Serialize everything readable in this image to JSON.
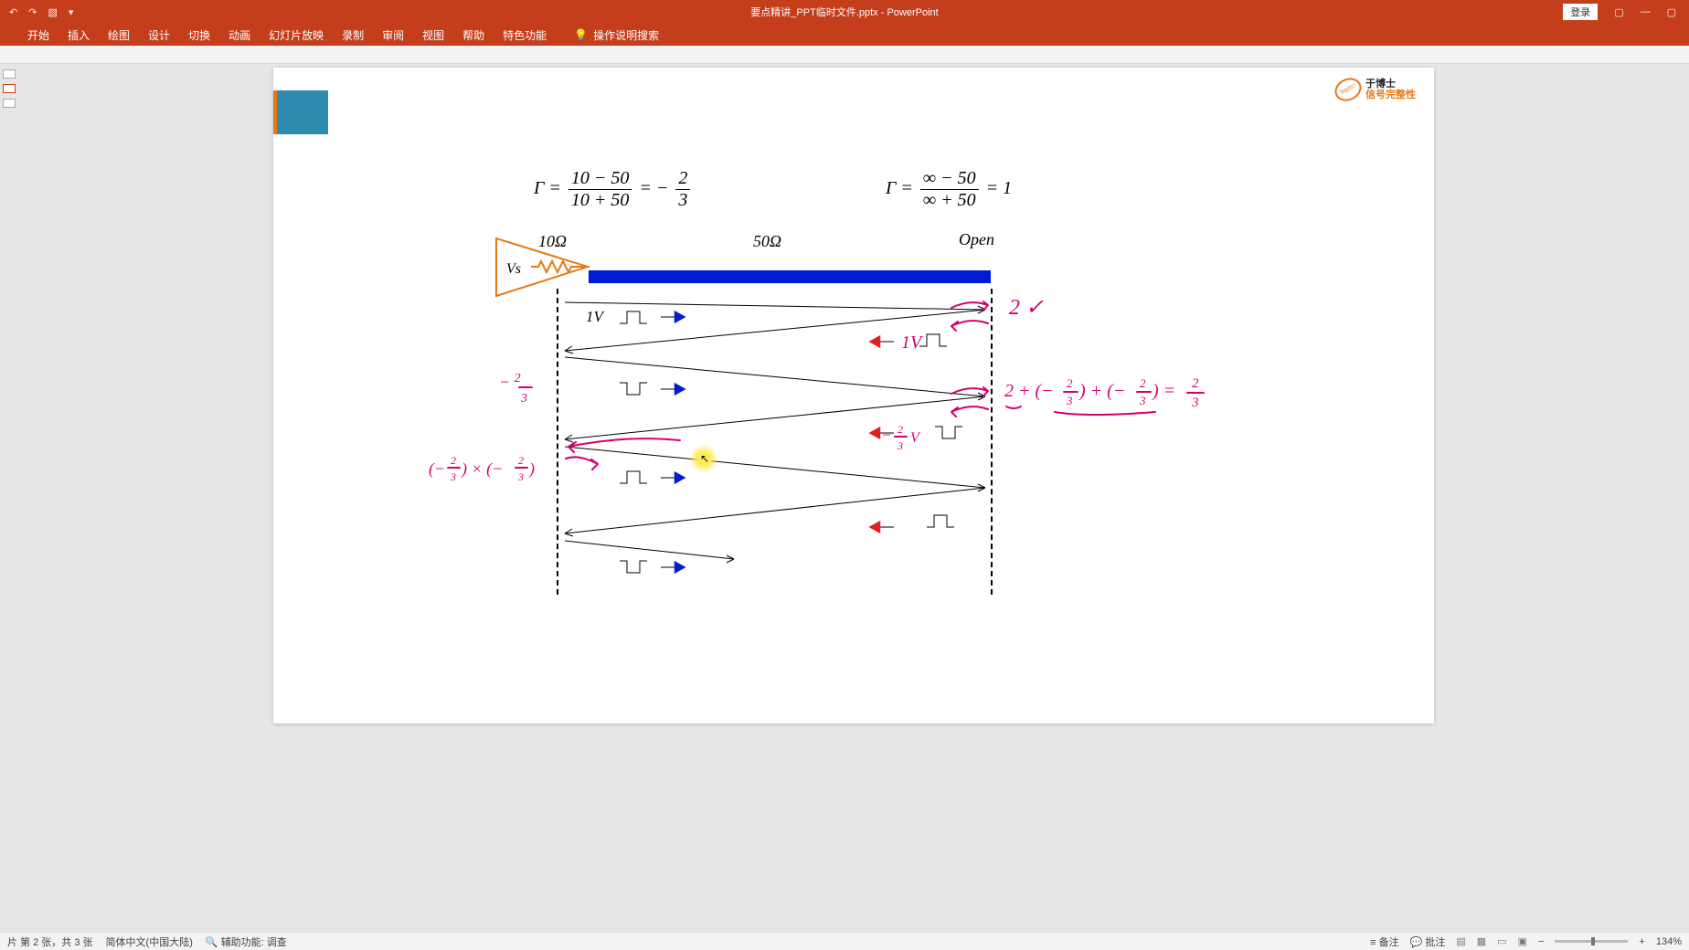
{
  "app": {
    "title": "要点精讲_PPT临时文件.pptx - PowerPoint",
    "login_label": "登录"
  },
  "ribbon": {
    "tabs": [
      "开始",
      "插入",
      "绘图",
      "设计",
      "切换",
      "动画",
      "幻灯片放映",
      "录制",
      "审阅",
      "视图",
      "帮助",
      "特色功能"
    ],
    "search_hint": "操作说明搜索"
  },
  "slide": {
    "formula_left_gamma": "Γ =",
    "formula_left_num": "10 − 50",
    "formula_left_den": "10 + 50",
    "formula_left_eq": "= −",
    "formula_left_frac_num": "2",
    "formula_left_frac_den": "3",
    "formula_right_gamma": "Γ =",
    "formula_right_num": "∞ − 50",
    "formula_right_den": "∞ + 50",
    "formula_right_eq": "= 1",
    "label_10ohm": "10Ω",
    "label_50ohm": "50Ω",
    "label_open": "Open",
    "label_vs": "Vs",
    "label_1v": "1V",
    "logo_t1": "于博士",
    "logo_t2": "信号完整性",
    "logo_tag": "Sig007"
  },
  "annotations": {
    "right_2v": "2 V",
    "right_1v": "1V",
    "left_neg23": "−",
    "calc_sum": "2 + (−²⁄₃) + (−²⁄₃) = ²⁄₃",
    "left_mult": "(−²⁄₃) × (−²⁄₃)",
    "mid_neg23v": "−²⁄₃ V"
  },
  "status": {
    "slide_info": "片 第 2 张，共 3 张",
    "lang": "简体中文(中国大陆)",
    "access": "辅助功能: 调查",
    "notes": "备注",
    "comments": "批注",
    "zoom": "134%"
  }
}
